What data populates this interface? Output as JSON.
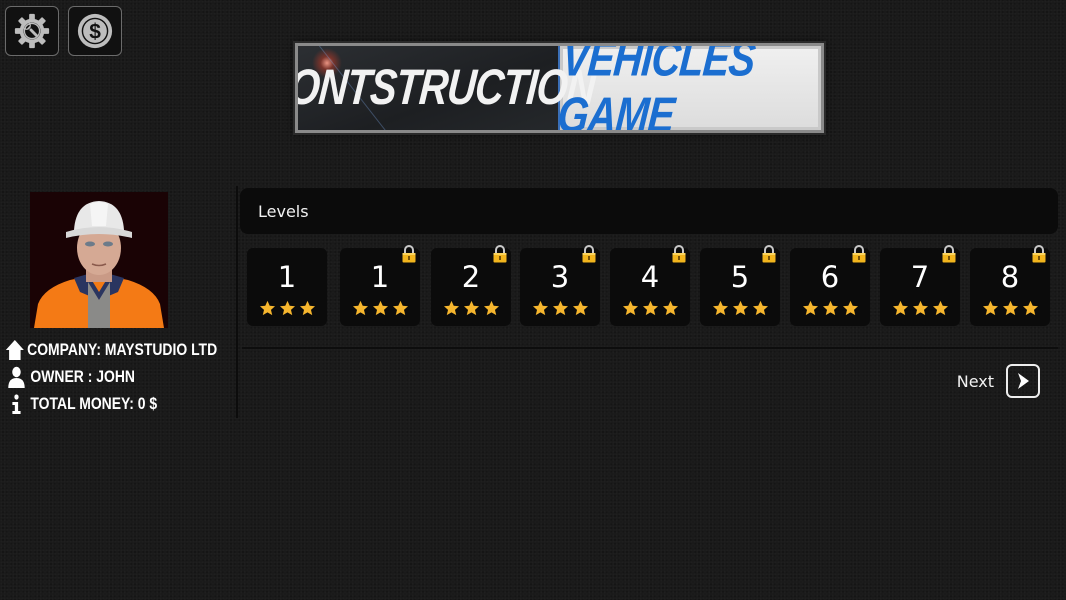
{
  "toolbar": {
    "settings_icon": "gear-wrench-icon",
    "money_icon": "dollar-coin-icon"
  },
  "banner": {
    "left_text": "Contstruction",
    "right_text": "Vehicles Game",
    "left_color": "#f2f2f2",
    "right_color": "#1b6ed0"
  },
  "profile": {
    "avatar": "construction-worker-avatar",
    "company": "COMPANY: MAYSTUDIO LTD",
    "owner": "OWNER : JOHN",
    "money": "TOTAL MONEY: 0 $"
  },
  "levels": {
    "title": "Levels",
    "items": [
      {
        "label": "1",
        "stars": 3,
        "locked": false
      },
      {
        "label": "1",
        "stars": 3,
        "locked": true
      },
      {
        "label": "2",
        "stars": 3,
        "locked": true
      },
      {
        "label": "3",
        "stars": 3,
        "locked": true
      },
      {
        "label": "4",
        "stars": 3,
        "locked": true
      },
      {
        "label": "5",
        "stars": 3,
        "locked": true
      },
      {
        "label": "6",
        "stars": 3,
        "locked": true
      },
      {
        "label": "7",
        "stars": 3,
        "locked": true
      },
      {
        "label": "8",
        "stars": 3,
        "locked": true
      }
    ],
    "star_color": "#f6b62e",
    "lock_color": "#f2b51d",
    "next_label": "Next"
  }
}
